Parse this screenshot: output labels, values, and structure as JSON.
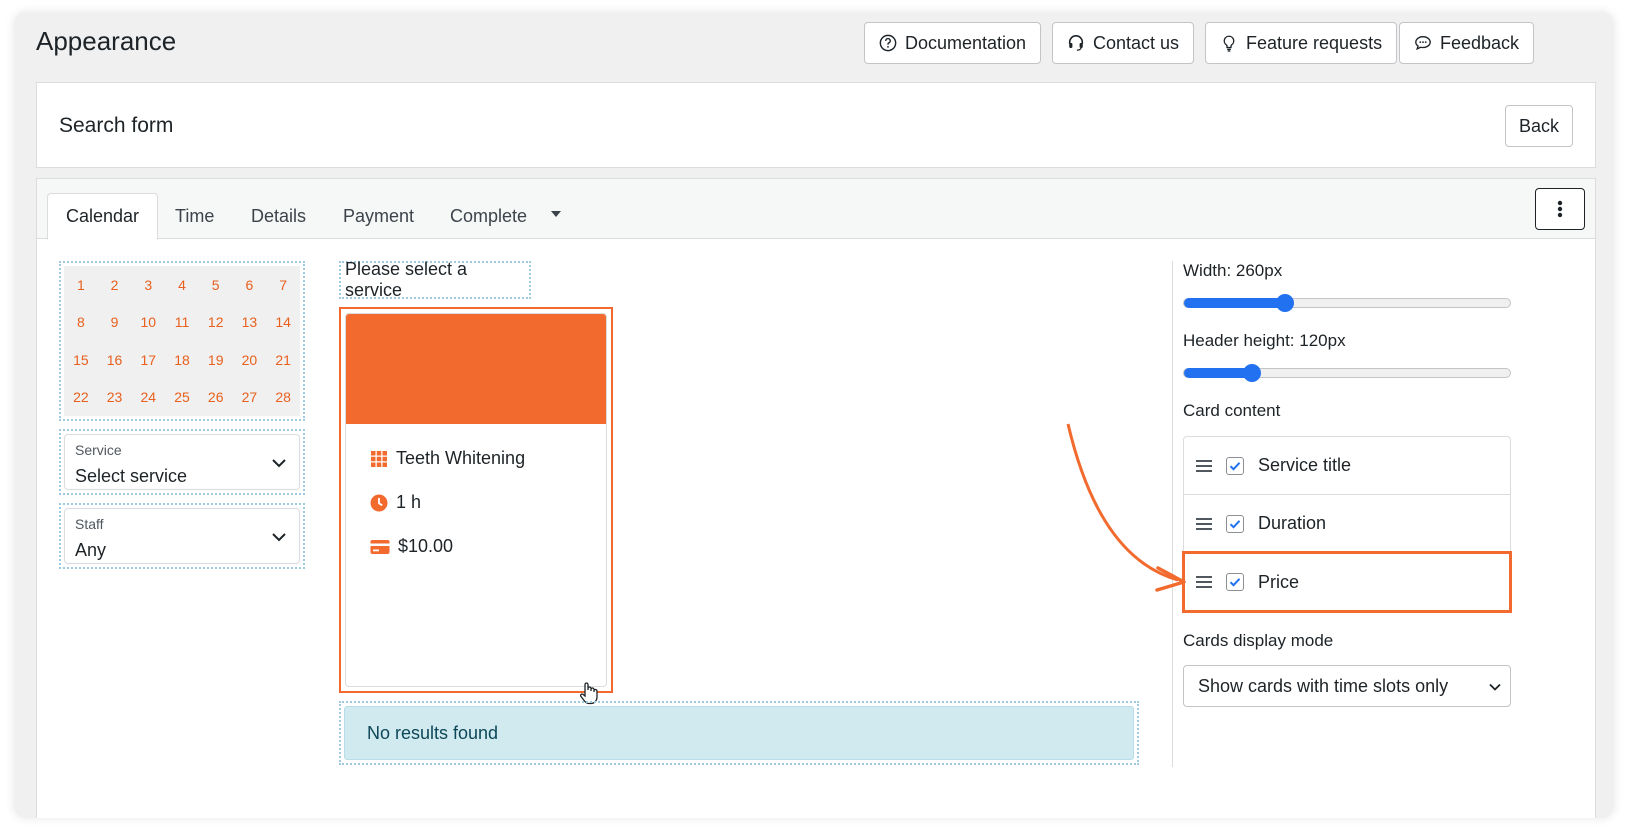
{
  "header": {
    "title": "Appearance",
    "buttons": {
      "documentation": "Documentation",
      "contact": "Contact us",
      "feature_requests": "Feature requests",
      "feedback": "Feedback"
    }
  },
  "panel": {
    "title": "Search form",
    "back": "Back"
  },
  "tabs": [
    "Calendar",
    "Time",
    "Details",
    "Payment",
    "Complete"
  ],
  "active_tab": "Calendar",
  "calendar": {
    "days": [
      "1",
      "2",
      "3",
      "4",
      "5",
      "6",
      "7",
      "8",
      "9",
      "10",
      "11",
      "12",
      "13",
      "14",
      "15",
      "16",
      "17",
      "18",
      "19",
      "20",
      "21",
      "22",
      "23",
      "24",
      "25",
      "26",
      "27",
      "28"
    ]
  },
  "filters": {
    "service": {
      "label": "Service",
      "value": "Select service"
    },
    "staff": {
      "label": "Staff",
      "value": "Any"
    }
  },
  "preview": {
    "hint": "Please select a service",
    "card": {
      "title": "Teeth Whitening",
      "duration": "1 h",
      "price": "$10.00"
    },
    "no_results": "No results found"
  },
  "settings": {
    "width_label": "Width: 260px",
    "width_level": 0.31,
    "header_height_label": "Header height: 120px",
    "header_height_level": 0.21,
    "card_content_label": "Card content",
    "card_content_items": [
      {
        "label": "Service title",
        "checked": true
      },
      {
        "label": "Duration",
        "checked": true
      },
      {
        "label": "Price",
        "checked": true
      }
    ],
    "display_mode_label": "Cards display mode",
    "display_mode_value": "Show cards with time slots only"
  },
  "colors": {
    "accent": "#f26a2e",
    "slider": "#2271f1",
    "info_bg": "#d1eaf0"
  }
}
